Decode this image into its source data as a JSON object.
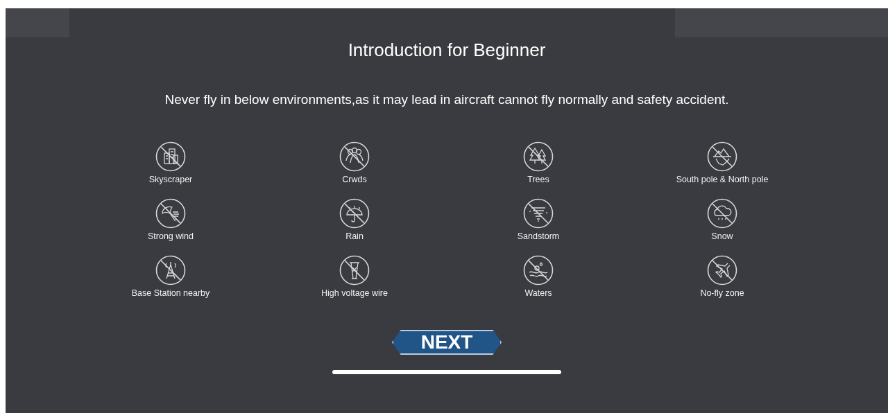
{
  "title": "Introduction for Beginner",
  "warning": "Never fly in below environments,as it may lead in aircraft cannot fly normally and safety accident.",
  "environments": [
    {
      "label": "Skyscraper",
      "kind": "buildings"
    },
    {
      "label": "Crwds",
      "kind": "people"
    },
    {
      "label": "Trees",
      "kind": "trees"
    },
    {
      "label": "South pole & North pole",
      "kind": "iceberg"
    },
    {
      "label": "Strong wind",
      "kind": "wind"
    },
    {
      "label": "Rain",
      "kind": "rain"
    },
    {
      "label": "Sandstorm",
      "kind": "tornado"
    },
    {
      "label": "Snow",
      "kind": "snow"
    },
    {
      "label": "Base Station nearby",
      "kind": "antenna"
    },
    {
      "label": "High voltage wire",
      "kind": "pylon"
    },
    {
      "label": "Waters",
      "kind": "water"
    },
    {
      "label": "No-fly zone",
      "kind": "plane"
    }
  ],
  "next_button": "NEXT"
}
